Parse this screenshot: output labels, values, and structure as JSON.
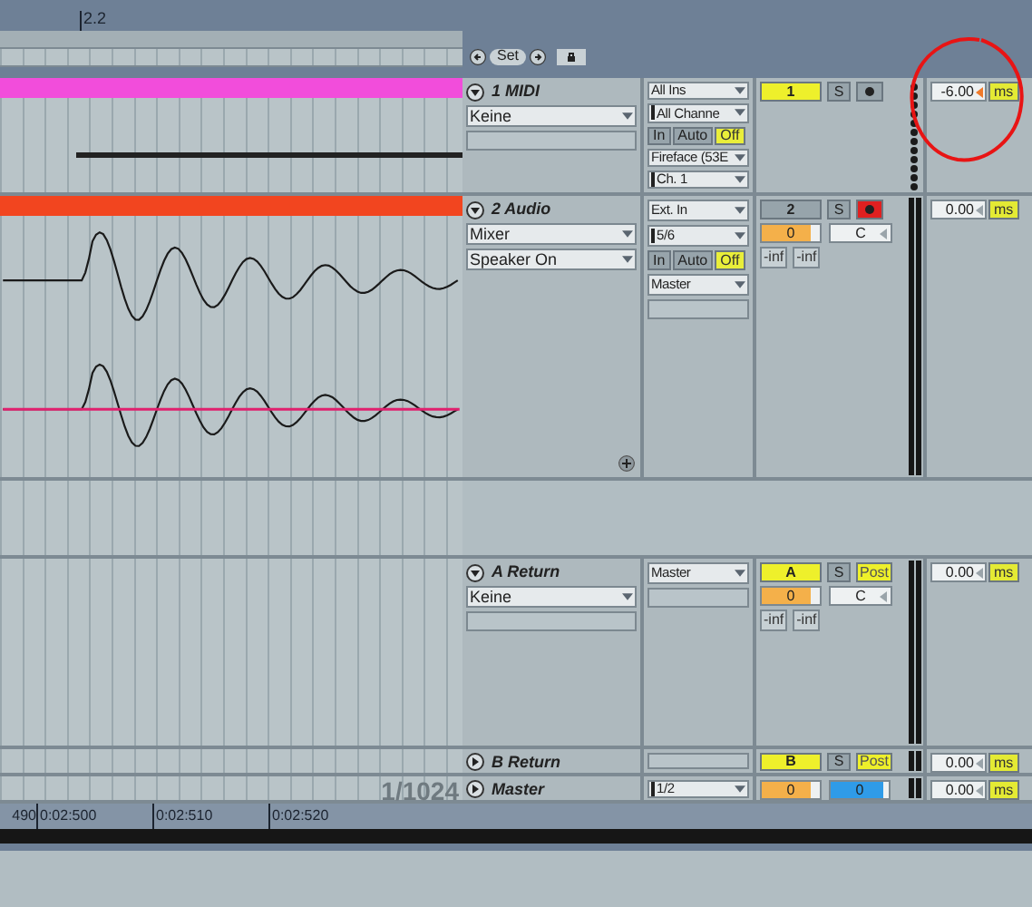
{
  "ruler": {
    "bar_label": "2.2"
  },
  "scene_controls": {
    "set_label": "Set"
  },
  "tracks": [
    {
      "kind": "midi",
      "name": "1 MIDI",
      "expanded": true,
      "clip": {
        "color": "#f24ddb"
      },
      "devices": [
        {
          "kind": "select",
          "value": "Keine"
        },
        {
          "kind": "field"
        }
      ],
      "io": [
        {
          "kind": "select",
          "value": "All Ins",
          "handle": false
        },
        {
          "kind": "select",
          "value": "All Channe",
          "handle": true
        },
        {
          "kind": "monitor",
          "options": [
            {
              "label": "In",
              "selected": false
            },
            {
              "label": "Auto",
              "selected": false
            },
            {
              "label": "Off",
              "selected": true
            }
          ]
        },
        {
          "kind": "select",
          "value": "Fireface (53E",
          "handle": false
        },
        {
          "kind": "select",
          "value": "Ch. 1",
          "handle": true
        }
      ],
      "mixer": {
        "activator": {
          "label": "1",
          "on": true
        },
        "solo": "S",
        "third": {
          "kind": "arm",
          "armed": false
        }
      },
      "meter": {
        "kind": "midi"
      },
      "delay": {
        "value": "-6.00",
        "unit": "ms",
        "focused": true
      }
    },
    {
      "kind": "audio",
      "name": "2 Audio",
      "expanded": true,
      "clip": {
        "color": "#f2451f"
      },
      "devices": [
        {
          "kind": "select",
          "value": "Mixer"
        },
        {
          "kind": "select",
          "value": "Speaker On"
        }
      ],
      "io": [
        {
          "kind": "select",
          "value": "Ext. In",
          "handle": false
        },
        {
          "kind": "select",
          "value": "5/6",
          "handle": true
        },
        {
          "kind": "monitor",
          "options": [
            {
              "label": "In",
              "selected": false
            },
            {
              "label": "Auto",
              "selected": false
            },
            {
              "label": "Off",
              "selected": true
            }
          ]
        },
        {
          "kind": "select",
          "value": "Master",
          "handle": false
        },
        {
          "kind": "field"
        }
      ],
      "mixer": {
        "activator": {
          "label": "2",
          "on": false
        },
        "solo": "S",
        "third": {
          "kind": "arm",
          "armed": true
        },
        "volume": {
          "value": "0",
          "level": 0.85
        },
        "pan": "C",
        "meters": [
          "-inf",
          "-inf"
        ]
      },
      "meter": {
        "kind": "audio"
      },
      "delay": {
        "value": "0.00",
        "unit": "ms",
        "focused": false
      }
    },
    {
      "kind": "return",
      "name": "A Return",
      "expanded": true,
      "devices": [
        {
          "kind": "select",
          "value": "Keine"
        },
        {
          "kind": "field"
        }
      ],
      "io": [
        {
          "kind": "select",
          "value": "Master",
          "handle": false
        },
        {
          "kind": "field"
        }
      ],
      "mixer": {
        "activator": {
          "label": "A",
          "on": true
        },
        "solo": "S",
        "third": {
          "kind": "post",
          "label": "Post"
        },
        "volume": {
          "value": "0",
          "level": 0.85
        },
        "pan": "C",
        "meters": [
          "-inf",
          "-inf"
        ]
      },
      "meter": {
        "kind": "audio"
      },
      "delay": {
        "value": "0.00",
        "unit": "ms",
        "focused": false
      }
    },
    {
      "kind": "return",
      "name": "B Return",
      "expanded": false,
      "io": [
        {
          "kind": "field"
        }
      ],
      "mixer": {
        "activator": {
          "label": "B",
          "on": true
        },
        "solo": "S",
        "third": {
          "kind": "post",
          "label": "Post"
        }
      },
      "meter": {
        "kind": "audio"
      },
      "delay": {
        "value": "0.00",
        "unit": "ms",
        "focused": false
      }
    },
    {
      "kind": "master",
      "name": "Master",
      "expanded": false,
      "grid_label": "1/1024",
      "io": [
        {
          "kind": "select",
          "value": "1/2",
          "handle": true
        }
      ],
      "mixer": {
        "volume": {
          "value": "0",
          "level": 0.85
        },
        "cue": {
          "value": "0",
          "level": 0.9
        }
      },
      "meter": {
        "kind": "audio"
      },
      "delay": {
        "value": "0.00",
        "unit": "ms",
        "focused": false
      }
    }
  ],
  "timeline": [
    "490",
    "0:02:500",
    "0:02:510",
    "0:02:520"
  ]
}
